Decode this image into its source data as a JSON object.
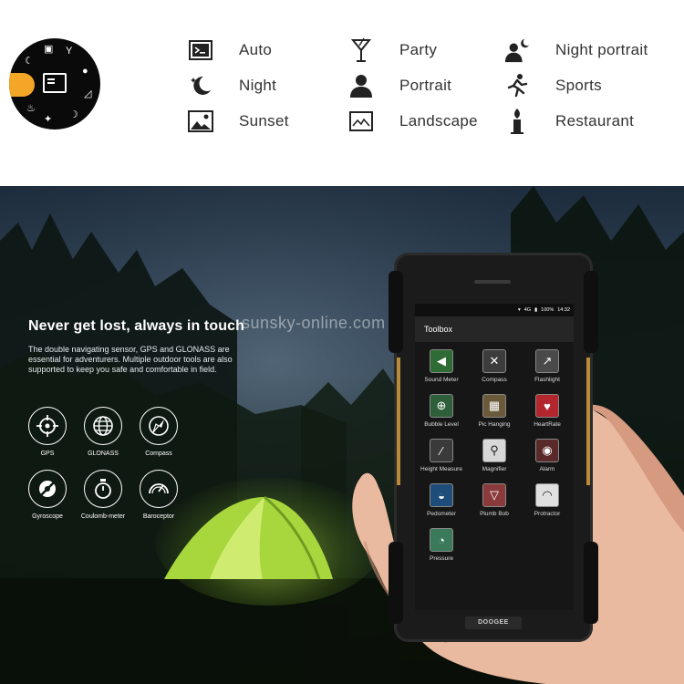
{
  "scene_modes": [
    {
      "label": "Auto",
      "icon": "auto-mode-icon"
    },
    {
      "label": "Night",
      "icon": "night-moon-icon"
    },
    {
      "label": "Sunset",
      "icon": "sunset-landscape-icon"
    },
    {
      "label": "Party",
      "icon": "cocktail-glass-icon"
    },
    {
      "label": "Portrait",
      "icon": "person-bust-icon"
    },
    {
      "label": "Landscape",
      "icon": "landscape-chart-icon"
    },
    {
      "label": "Night portrait",
      "icon": "night-portrait-icon"
    },
    {
      "label": "Sports",
      "icon": "running-person-icon"
    },
    {
      "label": "Restaurant",
      "icon": "candle-icon"
    }
  ],
  "headline": "Never get lost, always in touch",
  "description": "The double navigating sensor, GPS and GLONASS are essential for adventurers. Multiple outdoor tools are also supported to keep you safe and comfortable in field.",
  "watermark": "sunsky-online.com",
  "features": [
    {
      "label": "GPS",
      "icon": "gps-crosshair-icon"
    },
    {
      "label": "GLONASS",
      "icon": "globe-icon"
    },
    {
      "label": "Compass",
      "icon": "compass-icon"
    },
    {
      "label": "Gyroscope",
      "icon": "gyroscope-icon"
    },
    {
      "label": "Coulomb-meter",
      "icon": "stopwatch-icon"
    },
    {
      "label": "Baroceptor",
      "icon": "gauge-icon"
    }
  ],
  "phone": {
    "status_network": "4G",
    "status_battery": "100%",
    "status_time": "14:32",
    "app_title": "Toolbox",
    "brand": "DOOGEE",
    "tools": [
      {
        "label": "Sound Meter",
        "icon": "megaphone-icon"
      },
      {
        "label": "Compass",
        "icon": "compass-icon"
      },
      {
        "label": "Flashlight",
        "icon": "flashlight-icon"
      },
      {
        "label": "Bubble Level",
        "icon": "bubble-level-icon"
      },
      {
        "label": "Pic Hanging",
        "icon": "picture-frame-icon"
      },
      {
        "label": "HeartRate",
        "icon": "heart-icon"
      },
      {
        "label": "Height Measure",
        "icon": "ruler-diagonal-icon"
      },
      {
        "label": "Magnifier",
        "icon": "magnifier-icon"
      },
      {
        "label": "Alarm",
        "icon": "alarm-icon"
      },
      {
        "label": "Pedometer",
        "icon": "pedometer-icon"
      },
      {
        "label": "Plumb Bob",
        "icon": "plumb-bob-icon"
      },
      {
        "label": "Protractor",
        "icon": "protractor-icon"
      },
      {
        "label": "Pressure",
        "icon": "pressure-icon"
      }
    ]
  },
  "colors": {
    "accent": "#f4a626",
    "phone_gold": "#b98a3a",
    "tent_green": "#b6e04a"
  }
}
